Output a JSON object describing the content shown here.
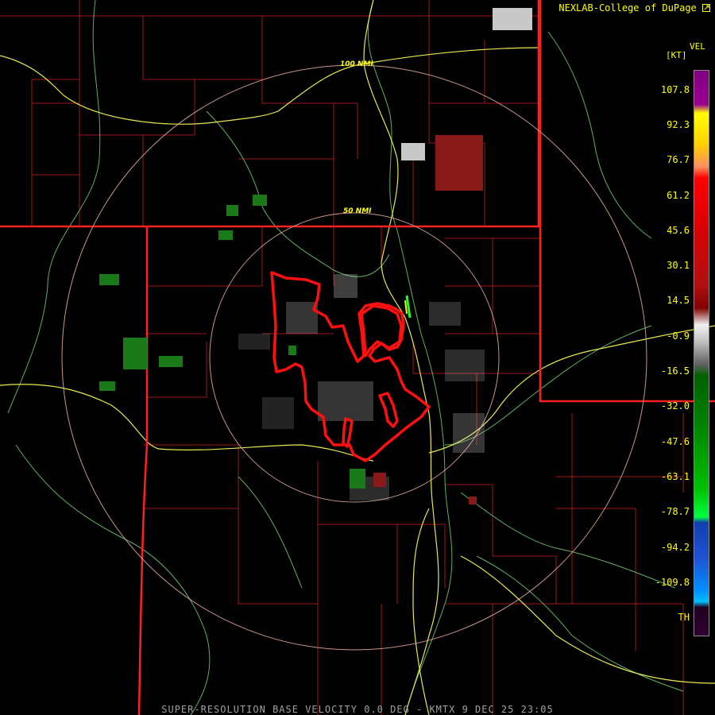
{
  "header": {
    "credit": "NEXLAB-College of DuPage",
    "credit_icon": "external-link-icon"
  },
  "footer": {
    "title": "SUPER-RESOLUTION BASE VELOCITY 0.0 DEG - KMTX 9 DEC 25 23:05"
  },
  "rings": [
    {
      "label": "50 NMI"
    },
    {
      "label": "100 NMI"
    }
  ],
  "legend": {
    "product": "VEL",
    "unit": "[KT]",
    "ticks": [
      "107.8",
      "92.3",
      "76.7",
      "61.2",
      "45.6",
      "30.1",
      "14.5",
      "-0.9",
      "-16.5",
      "-32.0",
      "-47.6",
      "-63.1",
      "-78.7",
      "-94.2",
      "-109.8",
      "TH"
    ]
  },
  "colors": {
    "background": "#000000",
    "state_border": "#ff2020",
    "county_border": "#a01818",
    "highway": "#e8e850",
    "river": "#60b060",
    "range_ring": "#e8b0a0",
    "warning_polygon": "#ff1010",
    "text": "#ffff00"
  }
}
